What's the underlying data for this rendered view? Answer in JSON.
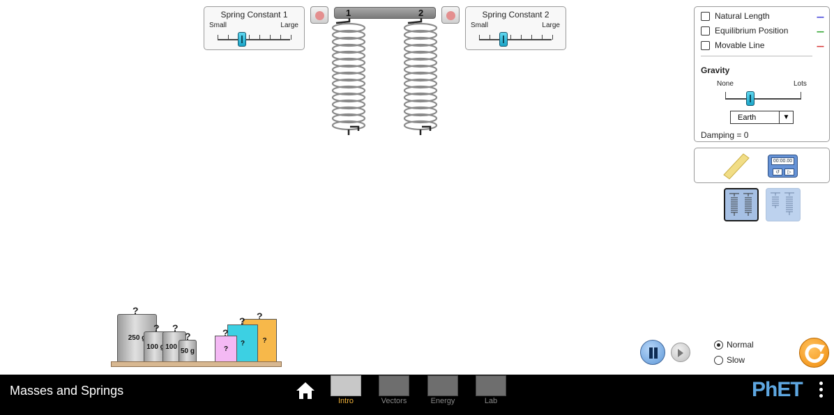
{
  "sim": {
    "spring1": {
      "title": "Spring Constant 1",
      "small": "Small",
      "large": "Large",
      "level": 0.33
    },
    "spring2": {
      "title": "Spring Constant 2",
      "small": "Small",
      "large": "Large",
      "level": 0.33
    },
    "hanger": {
      "label1": "1",
      "label2": "2"
    }
  },
  "controls": {
    "checkboxes": [
      {
        "label": "Natural Length",
        "dash": "---",
        "color": "#3d3dd8",
        "checked": false
      },
      {
        "label": "Equilibrium Position",
        "dash": "---",
        "color": "#2aa22a",
        "checked": false
      },
      {
        "label": "Movable Line",
        "dash": "---",
        "color": "#d83a3a",
        "checked": false
      }
    ],
    "gravity": {
      "title": "Gravity",
      "none": "None",
      "lots": "Lots",
      "level": 0.33,
      "planet": "Earth"
    },
    "damping": "Damping = 0"
  },
  "tools": {
    "stopwatch_display": "00:00.00"
  },
  "masses": {
    "labeled": [
      {
        "label": "250 g"
      },
      {
        "label": "100 g"
      },
      {
        "label": "100 g"
      },
      {
        "label": "50 g"
      }
    ],
    "mystery_label": "?"
  },
  "playback": {
    "speed_options": [
      {
        "label": "Normal",
        "selected": true
      },
      {
        "label": "Slow",
        "selected": false
      }
    ]
  },
  "navbar": {
    "title": "Masses and Springs",
    "tabs": [
      {
        "label": "Intro",
        "active": true
      },
      {
        "label": "Vectors",
        "active": false
      },
      {
        "label": "Energy",
        "active": false
      },
      {
        "label": "Lab",
        "active": false
      }
    ],
    "logo": "PhET"
  },
  "colors": {
    "accent_orange": "#f2b23a",
    "thumb_cyan": "#1aa5c8",
    "reset_orange": "#f08c0c",
    "phet_blue": "#5ea7e1"
  }
}
